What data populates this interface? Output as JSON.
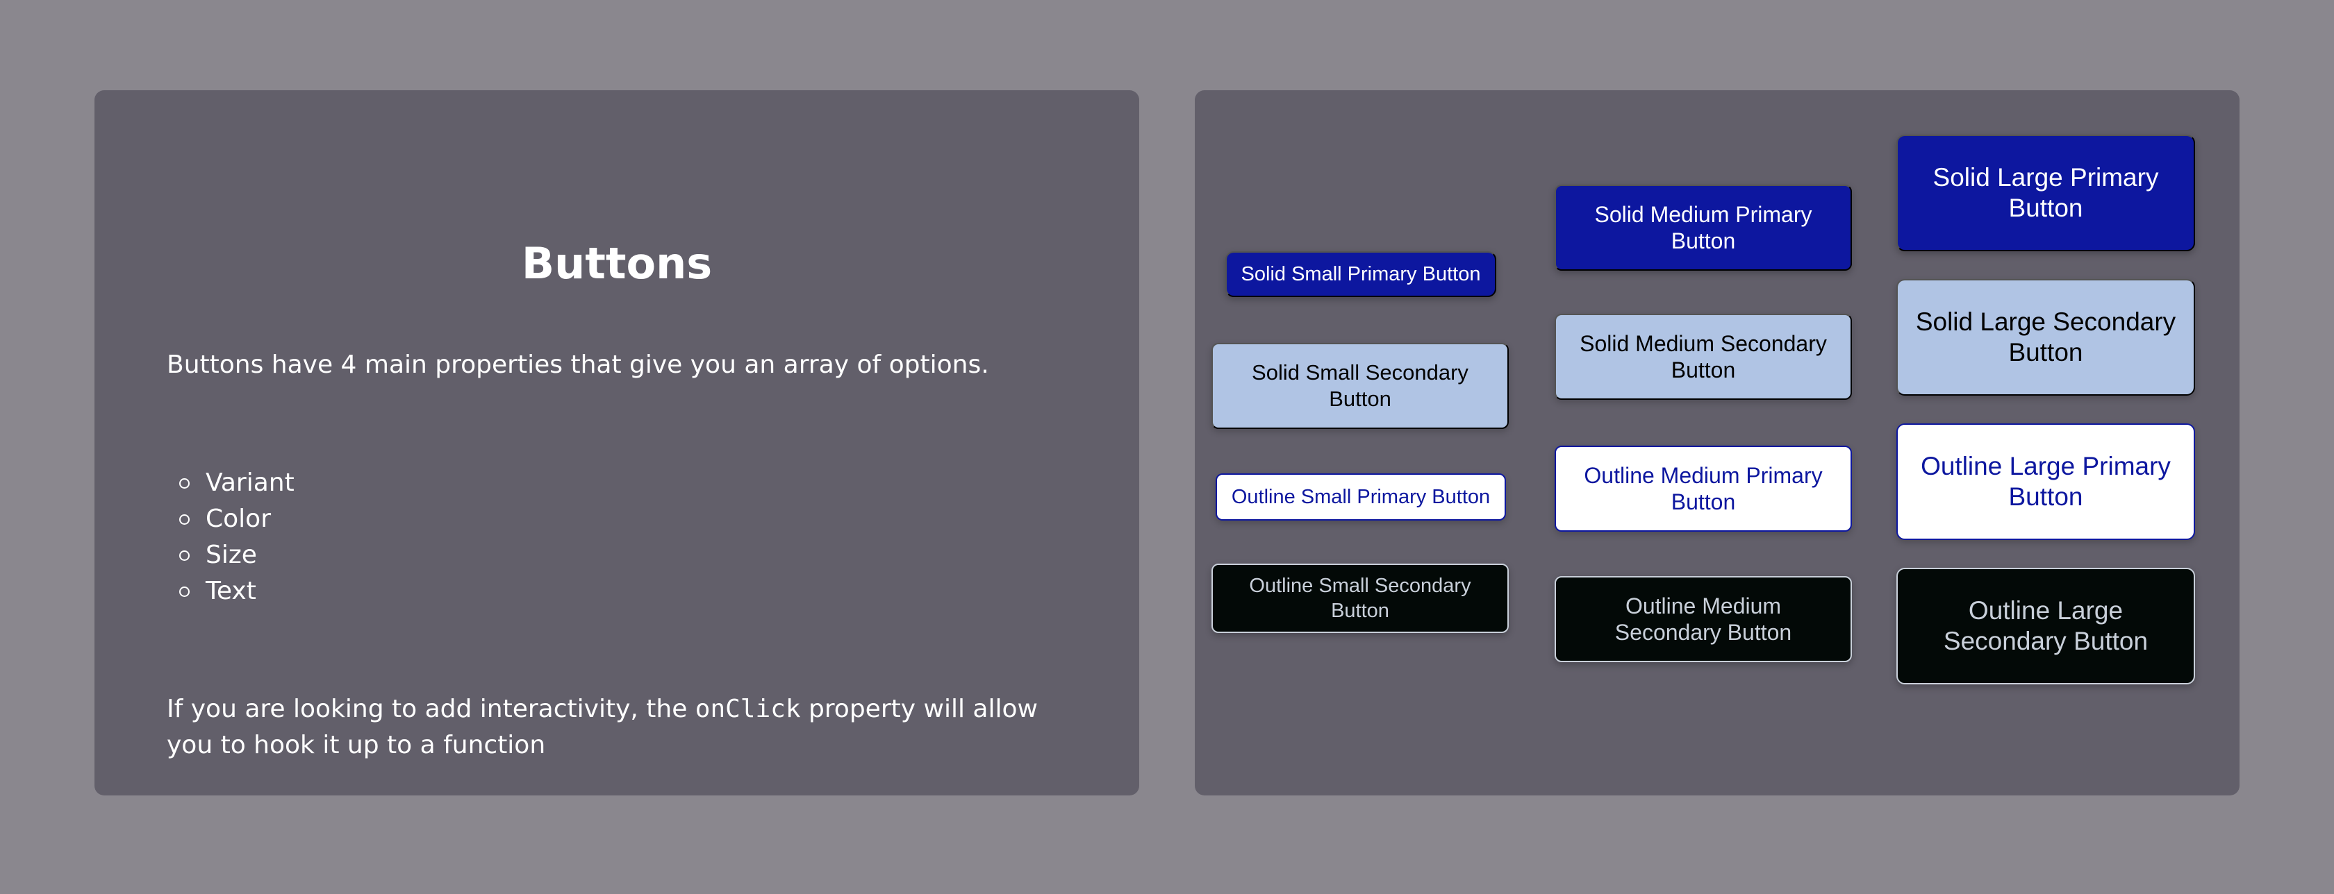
{
  "info": {
    "title": "Buttons",
    "intro": "Buttons have 4 main properties that give you an array of options.",
    "properties": [
      "Variant",
      "Color",
      "Size",
      "Text"
    ],
    "outro_before": "If you are looking to add interactivity, the ",
    "outro_code": "onClick",
    "outro_after": " property will allow you to hook it up to a function"
  },
  "buttons": {
    "small": {
      "solid_primary": "Solid Small Primary Button",
      "solid_secondary": "Solid Small Secondary Button",
      "outline_primary": "Outline Small Primary Button",
      "outline_secondary": "Outline Small Secondary Button"
    },
    "medium": {
      "solid_primary": "Solid Medium Primary Button",
      "solid_secondary": "Solid Medium Secondary Button",
      "outline_primary": "Outline Medium Primary Button",
      "outline_secondary": "Outline Medium Secondary Button"
    },
    "large": {
      "solid_primary": "Solid Large Primary Button",
      "solid_secondary": "Solid Large Secondary Button",
      "outline_primary": "Outline Large Primary Button",
      "outline_secondary": "Outline Large Secondary Button"
    }
  },
  "colors": {
    "background": "#8a878e",
    "panel": "#625f6a",
    "primary": "#0d179f",
    "secondary": "#b0c4e4",
    "outline_secondary_bg": "#030907"
  }
}
